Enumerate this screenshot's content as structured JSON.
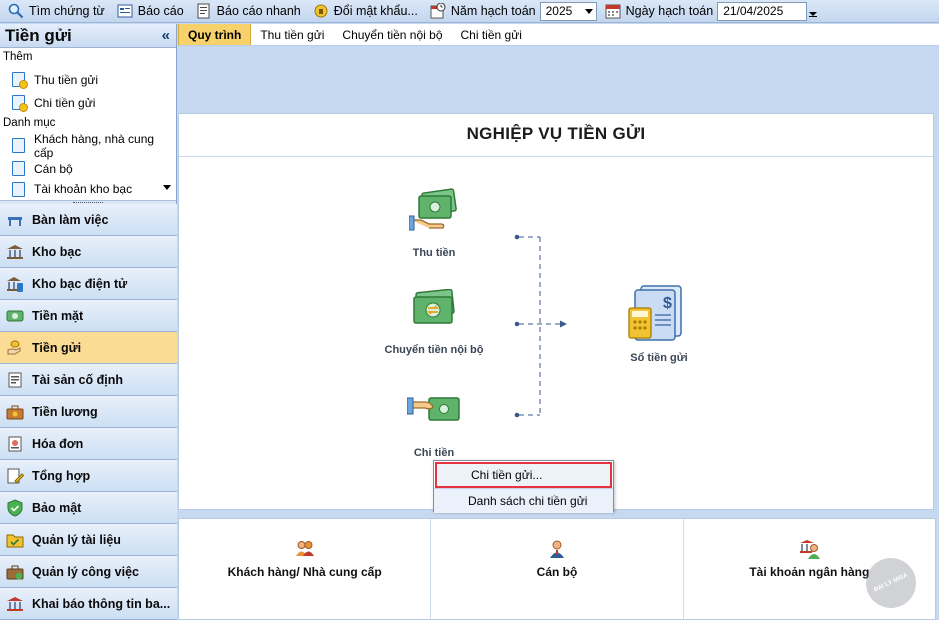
{
  "toolbar": {
    "search_voucher": "Tìm chứng từ",
    "report": "Báo cáo",
    "quick_report": "Báo cáo nhanh",
    "change_password": "Đổi mật khẩu...",
    "fiscal_year_label": "Năm hạch toán",
    "fiscal_year_value": "2025",
    "posting_date_label": "Ngày hạch toán",
    "posting_date_value": "21/04/2025"
  },
  "sidebar": {
    "title": "Tiền gửi",
    "collapse": "«",
    "group_add": "Thêm",
    "add_items": [
      "Thu tiền gửi",
      "Chi tiền gửi"
    ],
    "group_catalog": "Danh mục",
    "catalog_items": [
      "Khách hàng, nhà cung cấp",
      "Cán bộ",
      "Tài khoản kho bạc"
    ],
    "nav": [
      "Bàn làm việc",
      "Kho bạc",
      "Kho bạc điện tử",
      "Tiền mặt",
      "Tiền gửi",
      "Tài sản cố định",
      "Tiền lương",
      "Hóa đơn",
      "Tổng hợp",
      "Bảo mật",
      "Quản lý tài liệu",
      "Quản lý công việc",
      "Khai báo thông tin ba..."
    ]
  },
  "tabs": [
    "Quy trình",
    "Thu tiền gửi",
    "Chuyển tiền nội bộ",
    "Chi tiền gửi"
  ],
  "panel": {
    "title": "NGHIỆP VỤ TIỀN GỬI",
    "receive": "Thu tiền",
    "internal_transfer": "Chuyển tiền nội bộ",
    "pay": "Chi tiền",
    "deposit_book": "Sổ tiền gửi"
  },
  "bottom": {
    "customers": "Khách hàng/ Nhà cung cấp",
    "staff": "Cán bộ",
    "bank_account": "Tài khoản ngân hàng"
  },
  "context_menu": {
    "item1": "Chi tiền gửi...",
    "item2": "Danh sách chi tiền gửi"
  },
  "watermark": "ĐẠI LÝ MISA",
  "colors": {
    "active_tab": "#f7d26b",
    "active_nav": "#fbdc94",
    "highlight_border": "#e5343f",
    "money_green": "#5fb36b"
  }
}
